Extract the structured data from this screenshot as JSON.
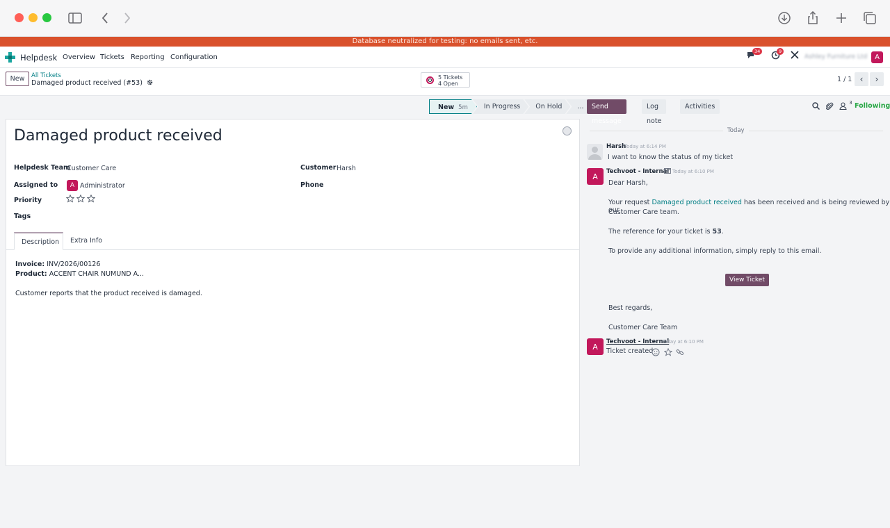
{
  "banner": "Database neutralized for testing: no emails sent, etc.",
  "nav": {
    "app_name": "Helpdesk",
    "menu": [
      "Overview",
      "Tickets",
      "Reporting",
      "Configuration"
    ],
    "discuss_count": "34",
    "activity_count": "9",
    "company": "Ashley Furniture Ltd",
    "user_initial": "A"
  },
  "control": {
    "new_label": "New",
    "breadcrumb_parent": "All Tickets",
    "breadcrumb_current": "Damaged product received (#53)",
    "smart_tickets": "5 Tickets",
    "smart_open": "4 Open",
    "pager": "1 / 1"
  },
  "stages": [
    {
      "label": "New",
      "duration": "5m"
    },
    {
      "label": "In Progress"
    },
    {
      "label": "On Hold"
    },
    {
      "label": "..."
    }
  ],
  "ticket": {
    "title": "Damaged product received",
    "helpdesk_team_label": "Helpdesk Team",
    "helpdesk_team": "Customer Care",
    "assigned_to_label": "Assigned to",
    "assigned_to": "Administrator",
    "assigned_initial": "A",
    "priority_label": "Priority",
    "tags_label": "Tags",
    "customer_label": "Customer",
    "customer": "Harsh",
    "phone_label": "Phone",
    "tabs": [
      "Description",
      "Extra Info"
    ],
    "invoice_label": "Invoice:",
    "invoice": "INV/2026/00126",
    "product_label": "Product:",
    "product": "ACCENT CHAIR NUMUND A...",
    "description": "Customer reports that the product received is damaged."
  },
  "chatter": {
    "send_message": "Send message",
    "log_note": "Log note",
    "activities": "Activities",
    "followers_count": "3",
    "following": "Following",
    "day_separator": "Today",
    "messages": [
      {
        "author": "Harsh",
        "time": "Today at 6:14 PM",
        "text": "I want to know the status of my ticket"
      },
      {
        "author": "Techvoot - Internal",
        "time": "Today at 6:10 PM",
        "greeting": "Dear Harsh,",
        "line1_pre": "Your request ",
        "line1_link": "Damaged product received",
        "line1_post": " has been received and is being reviewed by our",
        "line2": "Customer Care team.",
        "ref_pre": "The reference for your ticket is ",
        "ref_num": "53",
        "ref_post": ".",
        "info": "To provide any additional information, simply reply to this email.",
        "button": "View Ticket",
        "regards": "Best regards,",
        "signature": "Customer Care Team",
        "initial": "A"
      },
      {
        "author": "Techvoot - Internal",
        "time": "Today at 6:10 PM",
        "text": "Ticket created",
        "initial": "A"
      }
    ]
  },
  "colors": {
    "brand": "#714b67",
    "link": "#017e84",
    "banner": "#d9512c",
    "avatar": "#c2185b",
    "following": "#28a745"
  }
}
